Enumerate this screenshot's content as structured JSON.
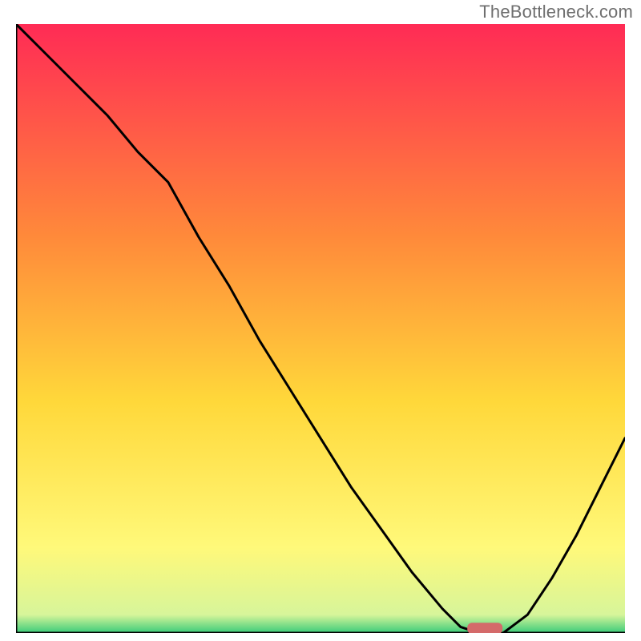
{
  "watermark": "TheBottleneck.com",
  "chart_data": {
    "type": "line",
    "title": "",
    "xlabel": "",
    "ylabel": "",
    "xlim": [
      0,
      100
    ],
    "ylim": [
      0,
      100
    ],
    "grid": false,
    "series": [
      {
        "name": "bottleneck-curve",
        "x": [
          0,
          5,
          10,
          15,
          20,
          25,
          30,
          35,
          40,
          45,
          50,
          55,
          60,
          65,
          70,
          73,
          76,
          80,
          84,
          88,
          92,
          96,
          100
        ],
        "y": [
          100,
          95,
          90,
          85,
          79,
          74,
          65,
          57,
          48,
          40,
          32,
          24,
          17,
          10,
          4,
          1,
          0,
          0,
          3,
          9,
          16,
          24,
          32
        ]
      }
    ],
    "marker": {
      "name": "optimal-point",
      "x": 77,
      "y": 0.5,
      "color": "#d46a6a"
    },
    "background_gradient": {
      "top": "#ff2b55",
      "mid1": "#ff8a3a",
      "mid2": "#ffd83a",
      "mid3": "#fff97a",
      "bottom": "#3acb7a"
    }
  }
}
